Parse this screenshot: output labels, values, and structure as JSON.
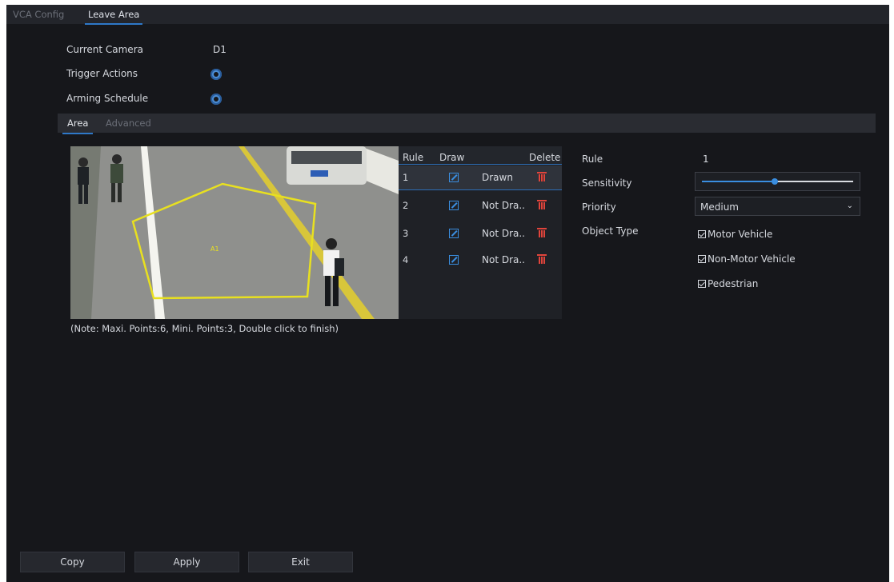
{
  "top_tabs": [
    {
      "label": "VCA Config"
    },
    {
      "label": "Leave Area"
    }
  ],
  "fields": {
    "current_camera_label": "Current Camera",
    "current_camera_value": "D1",
    "trigger_actions_label": "Trigger Actions",
    "arming_schedule_label": "Arming Schedule"
  },
  "sub_tabs": [
    {
      "label": "Area"
    },
    {
      "label": "Advanced"
    }
  ],
  "video": {
    "area_label": "A1"
  },
  "note": "(Note: Maxi. Points:6, Mini. Points:3, Double click to finish)",
  "rule_table": {
    "headers": {
      "rule": "Rule",
      "draw": "Draw",
      "delete": "Delete"
    },
    "rows": [
      {
        "rule": "1",
        "status": "Drawn"
      },
      {
        "rule": "2",
        "status": "Not Dra.."
      },
      {
        "rule": "3",
        "status": "Not Dra.."
      },
      {
        "rule": "4",
        "status": "Not Dra.."
      }
    ]
  },
  "props": {
    "rule_label": "Rule",
    "rule_value": "1",
    "sensitivity_label": "Sensitivity",
    "sensitivity_level": 0.48,
    "priority_label": "Priority",
    "priority_value": "Medium",
    "object_type_label": "Object Type",
    "object_types": [
      {
        "label": "Motor Vehicle",
        "checked": true
      },
      {
        "label": "Non-Motor Vehicle",
        "checked": true
      },
      {
        "label": "Pedestrian",
        "checked": true
      }
    ]
  },
  "buttons": {
    "copy": "Copy",
    "apply": "Apply",
    "exit": "Exit"
  },
  "colors": {
    "accent": "#3a8ee0",
    "delete": "#e0443b",
    "area_outline": "#e8e020",
    "background": "#16171b"
  }
}
